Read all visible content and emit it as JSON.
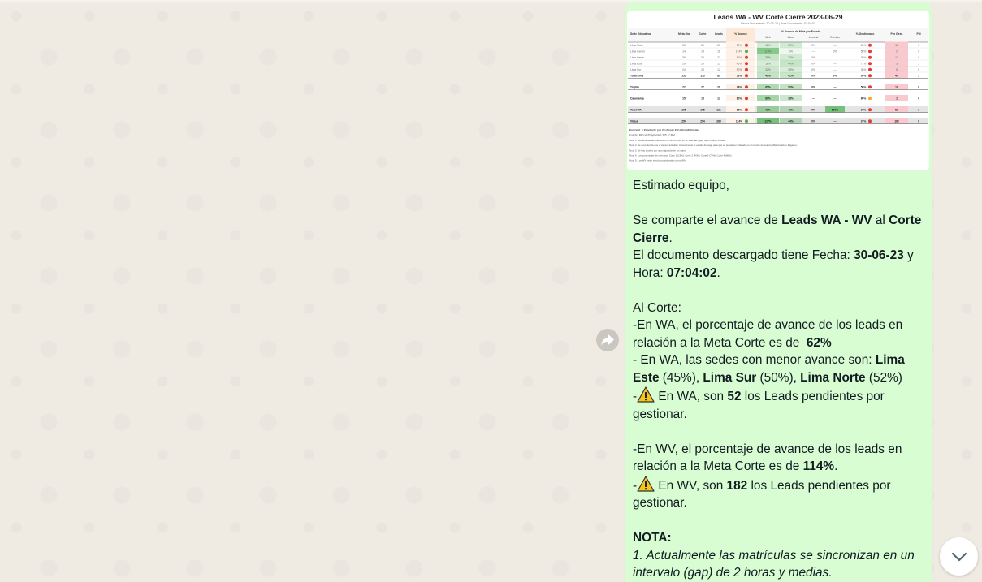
{
  "table_image": {
    "title": "Leads WA - WV Corte Cierre 2023-06-29",
    "subtitle": "Fecha Documento: 30-06-23 | Hora Documento: 07:04:02",
    "columns": [
      "Sede Educativa",
      "Meta Día",
      "Corte",
      "Leads",
      "% Avance",
      "% Avance de Meta por Fuente",
      "% Gestionado",
      "Por Gest.",
      "PM"
    ],
    "subcolumns": [
      "Web",
      "Inbox",
      "Inbound",
      "Eventos"
    ],
    "rows": [
      {
        "sede": "Lima Norte",
        "meta": "50",
        "corte": "50",
        "leads": "26",
        "avance": "52%",
        "web": "18%",
        "inbox": "30%",
        "inbound": "0%",
        "eventos": "—",
        "gest": "56%",
        "pend": "12",
        "pm": "0",
        "kind": "sub",
        "ok": false
      },
      {
        "sede": "Lima Centro",
        "meta": "14",
        "corte": "14",
        "leads": "16",
        "avance": "114%",
        "web": "114%",
        "inbox": "0%",
        "inbound": "—",
        "eventos": "0%",
        "gest": "58%",
        "pend": "2",
        "pm": "0",
        "kind": "sub",
        "ok": true
      },
      {
        "sede": "Lima Oeste",
        "meta": "36",
        "corte": "36",
        "leads": "22",
        "avance": "61%",
        "web": "38%",
        "inbox": "30%",
        "inbound": "0%",
        "eventos": "—",
        "gest": "35%",
        "pend": "13",
        "pm": "0",
        "kind": "sub",
        "ok": false
      },
      {
        "sede": "Lima Este",
        "meta": "29",
        "corte": "29",
        "leads": "13",
        "avance": "45%",
        "web": "18%",
        "inbox": "44%",
        "inbound": "0%",
        "eventos": "—",
        "gest": "71%",
        "pend": "3",
        "pm": "1",
        "kind": "sub",
        "ok": false
      },
      {
        "sede": "Lima Sur",
        "meta": "24",
        "corte": "24",
        "leads": "12",
        "avance": "50%",
        "web": "32%",
        "inbox": "25%",
        "inbound": "0%",
        "eventos": "—",
        "gest": "38%",
        "pend": "5",
        "pm": "0",
        "kind": "sub",
        "ok": false
      },
      {
        "sede": "Total Lima",
        "meta": "153",
        "corte": "153",
        "leads": "89",
        "avance": "58%",
        "web": "40%",
        "inbox": "41%",
        "inbound": "0%",
        "eventos": "0%",
        "gest": "34%",
        "pend": "47",
        "pm": "1",
        "kind": "total",
        "ok": false
      },
      {
        "sede": "Trujillo",
        "meta": "27",
        "corte": "27",
        "leads": "20",
        "avance": "74%",
        "web": "65%",
        "inbox": "50%",
        "inbound": "0%",
        "eventos": "—",
        "gest": "50%",
        "pend": "10",
        "pm": "0",
        "kind": "single",
        "ok": false
      },
      {
        "sede": "Cajamarca",
        "meta": "15",
        "corte": "15",
        "leads": "12",
        "avance": "80%",
        "web": "80%",
        "inbox": "38%",
        "inbound": "—",
        "eventos": "—",
        "gest": "80%",
        "pend": "1",
        "pm": "0",
        "kind": "single",
        "ok": false
      },
      {
        "sede": "Total WA",
        "meta": "195",
        "corte": "195",
        "leads": "121",
        "avance": "62%",
        "web": "72%",
        "inbox": "41%",
        "inbound": "0%",
        "eventos": "100%",
        "gest": "27%",
        "pend": "52",
        "pm": "1",
        "kind": "grand",
        "ok": false
      },
      {
        "sede": "Virtual",
        "meta": "254",
        "corte": "254",
        "leads": "289",
        "avance": "114%",
        "web": "127%",
        "inbox": "44%",
        "inbound": "0%",
        "eventos": "—",
        "gest": "37%",
        "pend": "182",
        "pm": "0",
        "kind": "grand",
        "ok": true
      }
    ],
    "notes": [
      "Por Gest. = Pendiente por Gestionar    PM = Por Matricular",
      "Fuente: Microsoft Dynamics 365 - CRM",
      "Nota 1: Actualmente las matrículas se sincronizan en un intervalo (gap) de 2 horas y medias.",
      "Nota 2: Se recomienda que el asesor actualice manualmente el estado de pago para que se pueda ver reflejado en el reporte de avance (Matriculado o Pagado).",
      "Nota 3: Se hay ajustes por una migración en los datos.",
      "Nota 4: Los porcentajes de corte son: Corte 1 (15%), Corte 2 (45%), Corte 3 (75%), Corte 4 (90%)",
      "Nota 5: Los WV están siendo considerados como WA."
    ]
  },
  "message": {
    "greeting": "Estimado equipo,",
    "share_prefix": "Se comparte el avance de ",
    "share_report": "Leads WA - WV",
    "share_mid": " al ",
    "share_cut": "Corte Cierre",
    "share_end": ".",
    "doc_prefix": "El documento descargado tiene Fecha: ",
    "doc_date": "30-06-23",
    "doc_mid": " y Hora: ",
    "doc_time": "07:04:02",
    "doc_end": ".",
    "al_corte": "Al Corte:",
    "wa_pct_prefix": "-En WA, el porcentaje de avance de los leads en relación a la Meta Corte es de  ",
    "wa_pct": "62%",
    "wa_low_prefix": "- En WA, las sedes con menor avance son: ",
    "wa_low_1": "Lima Este",
    "wa_low_1_pct": " (45%), ",
    "wa_low_2": "Lima Sur",
    "wa_low_2_pct": " (50%), ",
    "wa_low_3": "Lima Norte",
    "wa_low_3_pct": " (52%)",
    "wa_pend_prefix": " En WA, son ",
    "wa_pend": "52",
    "wa_pend_suffix": " los Leads pendientes por gestionar.",
    "wv_pct_prefix": "-En WV, el porcentaje de avance de los leads en relación a la Meta Corte es de ",
    "wv_pct": "114%",
    "wv_pct_end": ".",
    "wv_pend_prefix": " En WV, son ",
    "wv_pend": "182",
    "wv_pend_suffix": " los Leads pendientes por gestionar.",
    "nota_title": "NOTA:",
    "nota_1": "1. Actualmente las matrículas se sincronizan en un intervalo (gap) de 2 horas y medias."
  },
  "icons": {
    "forward": "forward-icon",
    "scroll_down": "chevron-down-icon",
    "warning": "warning-icon"
  },
  "colors": {
    "chat_bg": "#efeae2",
    "outgoing_bubble": "#d9fdd3",
    "text": "#111b21",
    "good_green": "#4caf50",
    "bad_red": "#e53935",
    "pending_pink": "#f8c9cf"
  }
}
